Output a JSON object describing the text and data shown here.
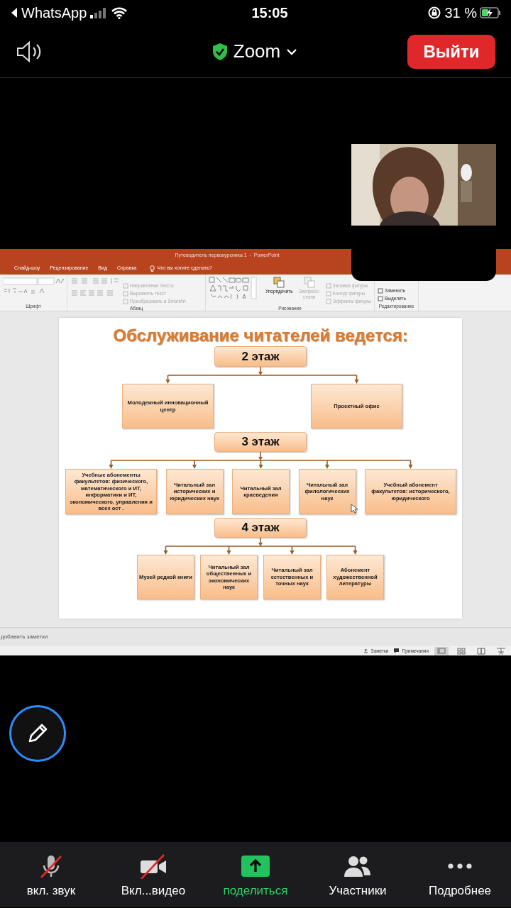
{
  "phone_status": {
    "app": "WhatsApp",
    "time": "15:05",
    "battery": "31 %"
  },
  "meeting_header": {
    "title": "Zoom",
    "leave_button": "Выйти"
  },
  "shared_screen": {
    "window_title": "Путеводитель первокурсника 1  -  PowerPoint",
    "tabs": [
      "Слайд-шоу",
      "Рецензирование",
      "Вид",
      "Справка"
    ],
    "tell_me": "Что вы хотите сделать?",
    "ribbon_groups": [
      {
        "kind": "font",
        "label": "Шрифт"
      },
      {
        "kind": "paragraph",
        "label": "Абзац",
        "commands": [
          {
            "label": "Направление текста",
            "kind": "small",
            "disabled": true
          },
          {
            "label": "Выровнять текст",
            "kind": "small",
            "disabled": true
          },
          {
            "label": "Преобразовать в SmartArt",
            "kind": "small",
            "disabled": true
          }
        ]
      },
      {
        "kind": "drawing",
        "label": "Рисование",
        "commands": [
          {
            "label": "Упорядочить",
            "kind": "large",
            "disabled": false
          },
          {
            "label": "Экспресс-стили",
            "kind": "large",
            "disabled": true
          },
          {
            "label": "Заливка фигуры",
            "kind": "small",
            "disabled": true
          },
          {
            "label": "Контур фигуры",
            "kind": "small",
            "disabled": true
          },
          {
            "label": "Эффекты фигуры",
            "kind": "small",
            "disabled": true
          }
        ]
      },
      {
        "kind": "editing",
        "label": "Редактирование",
        "commands": [
          {
            "label": "Заменить",
            "kind": "small",
            "disabled": false
          },
          {
            "label": "Выделить",
            "kind": "small",
            "disabled": false
          }
        ]
      }
    ],
    "slide": {
      "title": "Обслуживание читателей ведется:",
      "floors": [
        {
          "label": "2 этаж",
          "rooms": [
            "Молодежный инновационный центр",
            "Проектный офис"
          ]
        },
        {
          "label": "3 этаж",
          "rooms": [
            "Учебные абонементы факультетов: физического, математического и ИТ, информатики и ИТ, экономического, управления и всех ост .",
            "Читальный зал исторических и юридических наук",
            "Читальный зал краеведения",
            "Читальный зал филологических наук",
            "Учебный абонемент факультетов: исторического, юридического"
          ]
        },
        {
          "label": "4 этаж",
          "rooms": [
            "Музей редкой книги",
            "Читальный зал общественных и экономических наук",
            "Читальный зал естественных и точных наук",
            "Абонемент художественной литературы"
          ]
        }
      ]
    },
    "notes_placeholder": "добавить заметки",
    "status_buttons": [
      "Заметки",
      "Примечания"
    ],
    "views": [
      {
        "kind": "normal",
        "selected": true
      },
      {
        "kind": "sorter",
        "selected": false
      },
      {
        "kind": "reading",
        "selected": false
      },
      {
        "kind": "show",
        "selected": false
      }
    ]
  },
  "toolbar": [
    {
      "kind": "mic_off",
      "label": "вкл. звук"
    },
    {
      "kind": "video_off",
      "label": "Вкл...видео"
    },
    {
      "kind": "share",
      "label": "поделиться"
    },
    {
      "kind": "participants",
      "label": "Участники"
    },
    {
      "kind": "more",
      "label": "Подробнее"
    }
  ]
}
